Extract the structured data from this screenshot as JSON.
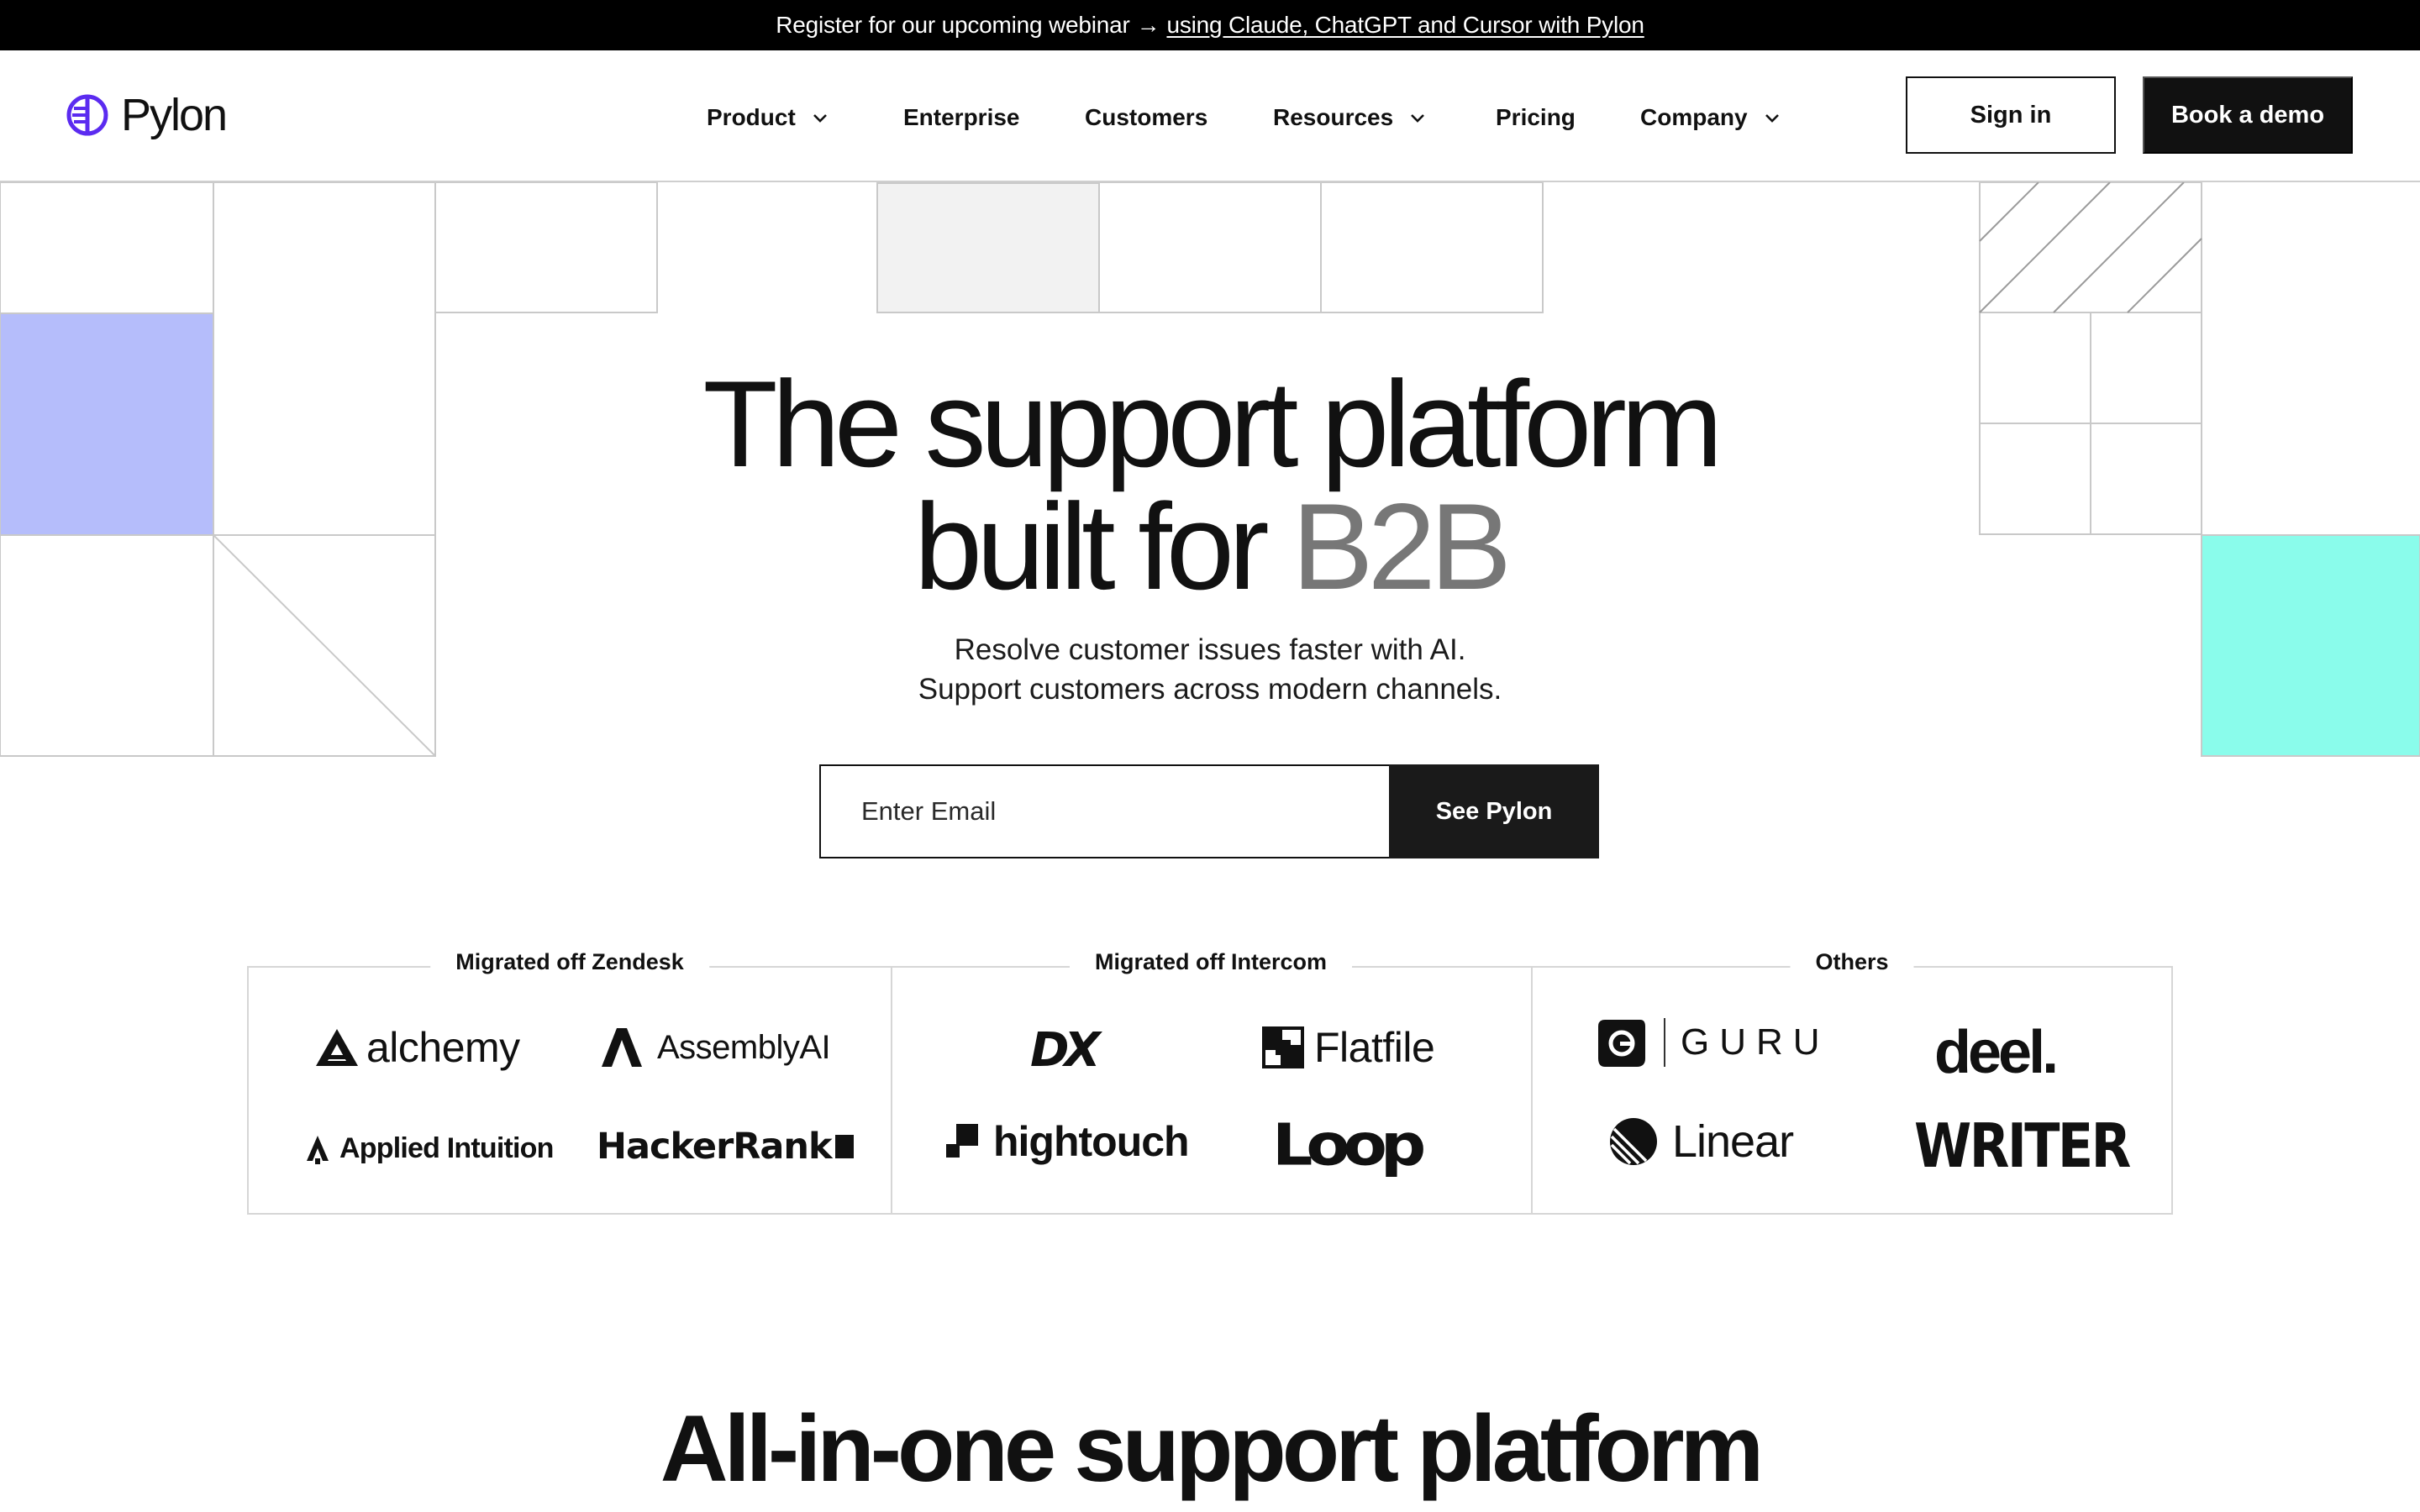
{
  "announcement": {
    "text": "Register for our upcoming webinar",
    "arrow": "→",
    "link": "using Claude, ChatGPT and Cursor with Pylon"
  },
  "brand": {
    "name": "Pylon",
    "accent_color": "#5b2bf0"
  },
  "nav": {
    "items": [
      {
        "label": "Product",
        "dropdown": true
      },
      {
        "label": "Enterprise",
        "dropdown": false
      },
      {
        "label": "Customers",
        "dropdown": false
      },
      {
        "label": "Resources",
        "dropdown": true
      },
      {
        "label": "Pricing",
        "dropdown": false
      },
      {
        "label": "Company",
        "dropdown": true
      }
    ],
    "sign_in": "Sign in",
    "book_demo": "Book a demo"
  },
  "hero": {
    "title_line1": "The support platform",
    "title_line2_prefix": "built for ",
    "title_line2_accent": "B2B",
    "subtitle_line1": "Resolve customer issues faster with AI.",
    "subtitle_line2": "Support customers across modern channels.",
    "email_placeholder": "Enter Email",
    "cta": "See Pylon"
  },
  "decor_colors": {
    "lavender": "#b5bdfb",
    "mint": "#8afceb",
    "gray": "#f2f2f2",
    "line": "#c9c9c9"
  },
  "customers": {
    "groups": [
      {
        "label": "Migrated off Zendesk",
        "logos": [
          "alchemy",
          "AssemblyAI",
          "Applied Intuition",
          "HackerRank"
        ]
      },
      {
        "label": "Migrated off Intercom",
        "logos": [
          "DX",
          "Flatfile",
          "hightouch",
          "Loop"
        ]
      },
      {
        "label": "Others",
        "logos": [
          "GURU",
          "deel.",
          "Linear",
          "WRITER"
        ]
      }
    ]
  },
  "section": {
    "title": "All-in-one support platform"
  }
}
